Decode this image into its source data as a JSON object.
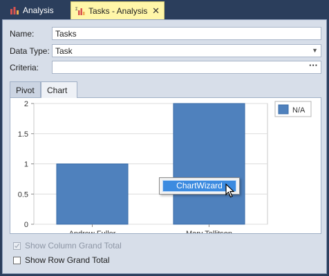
{
  "tabs": [
    {
      "label": "Analysis",
      "active": false,
      "icon": "analysis-report-icon"
    },
    {
      "label": "Tasks - Analysis",
      "active": true,
      "icon": "analysis-report-icon",
      "close_glyph": "✕"
    }
  ],
  "form": {
    "name_label": "Name:",
    "name_value": "Tasks",
    "datatype_label": "Data Type:",
    "datatype_value": "Task",
    "criteria_label": "Criteria:",
    "criteria_value": "",
    "criteria_button": "···"
  },
  "pivot_tabs": [
    {
      "label": "Pivot",
      "active": false
    },
    {
      "label": "Chart",
      "active": true
    }
  ],
  "chart_data": {
    "type": "bar",
    "categories": [
      "Andrew Fuller",
      "Mary Tellitson"
    ],
    "series": [
      {
        "name": "N/A",
        "values": [
          1,
          2
        ],
        "color": "#4f81bd"
      }
    ],
    "ylim": [
      0,
      2
    ],
    "yticks": [
      "0",
      "0.5",
      "1",
      "1.5",
      "2"
    ],
    "grid": true,
    "legend_position": "top-right"
  },
  "context_menu": {
    "items": [
      "ChartWizard"
    ]
  },
  "options": {
    "column_grand_total_label": "Show Column Grand Total",
    "column_grand_total_checked": true,
    "column_grand_total_enabled": false,
    "row_grand_total_label": "Show Row Grand Total",
    "row_grand_total_checked": false
  }
}
